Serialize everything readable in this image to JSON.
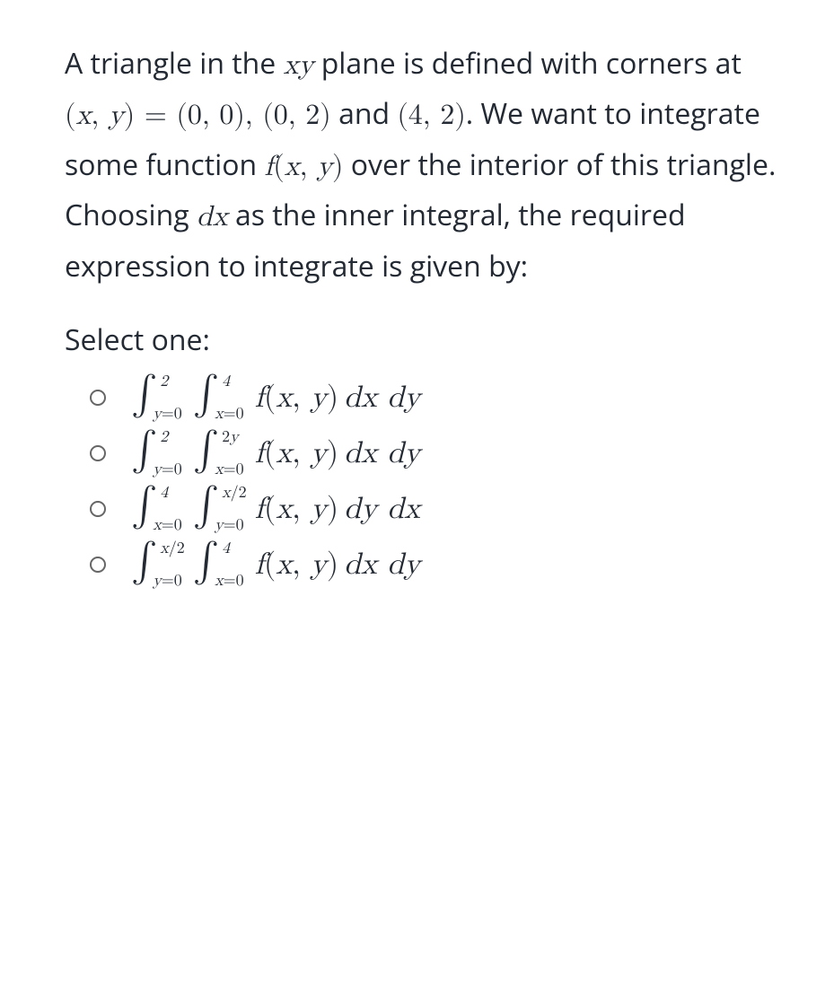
{
  "question": {
    "p1_html": "A triangle in the <span class='math'>xy</span> plane is defined with corners at <span class='math'><span class='roman'>(</span>x<span class='roman'>,</span> y<span class='roman'>) = (0, 0), (0, 2)</span></span> and <span class='math roman'>(4, 2)</span>. We want to integrate some function <span class='math'>f<span class='roman'>(</span>x<span class='roman'>,</span> y<span class='roman'>)</span></span> over the interior of this triangle.",
    "p2_html": "Choosing <span class='math'>dx</span> as the inner integral, the required expression to integrate is given by:"
  },
  "select_label": "Select one:",
  "integrand_html": "f<span class='roman'>(</span>x<span class='roman'>,</span> y<span class='roman'>)</span>",
  "options": [
    {
      "outer_upper": "2",
      "outer_lower_html": "y<span class='roman'>=0</span>",
      "inner_upper": "4",
      "inner_lower_html": "x<span class='roman'>=0</span>",
      "diff": "dx dy"
    },
    {
      "outer_upper": "2",
      "outer_lower_html": "y<span class='roman'>=0</span>",
      "inner_upper_html": "<span class='roman'>2</span>y",
      "inner_lower_html": "x<span class='roman'>=0</span>",
      "diff": "dx dy"
    },
    {
      "outer_upper": "4",
      "outer_lower_html": "x<span class='roman'>=0</span>",
      "inner_upper_html": "x<span class='roman'>/2</span>",
      "inner_lower_html": "y<span class='roman'>=0</span>",
      "diff": "dy dx"
    },
    {
      "outer_upper_html": "x<span class='roman'>/2</span>",
      "outer_lower_html": "y<span class='roman'>=0</span>",
      "inner_upper": "4",
      "inner_lower_html": "x<span class='roman'>=0</span>",
      "diff": "dx dy"
    }
  ]
}
